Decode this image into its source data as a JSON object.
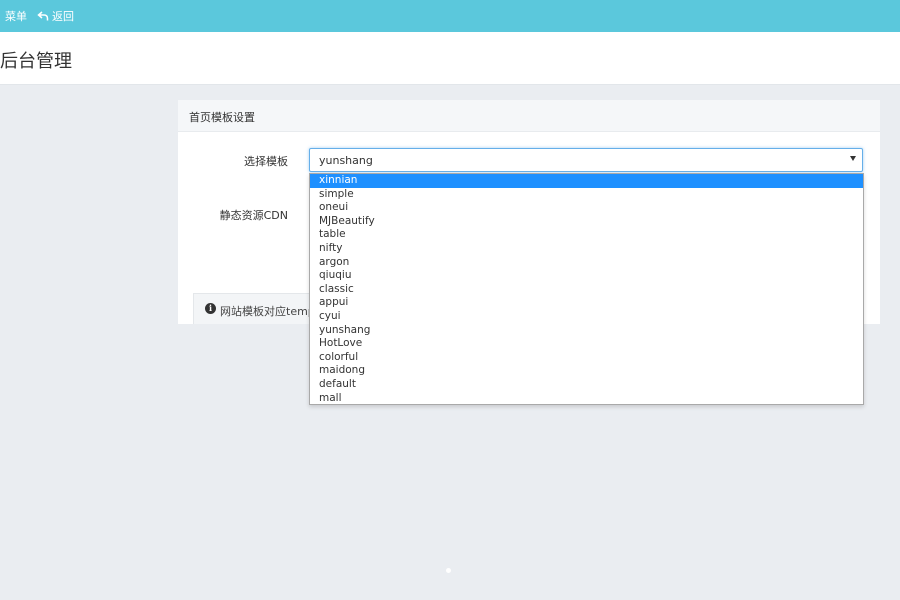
{
  "topbar": {
    "menu_label": "菜单",
    "back_label": "返回"
  },
  "header": {
    "title": "后台管理"
  },
  "panel": {
    "heading": "首页模板设置",
    "template_label": "选择模板",
    "template_value": "yunshang",
    "cdn_label": "静态资源CDN",
    "tip_text": "网站模板对应templ"
  },
  "dropdown": {
    "options": [
      "xinnian",
      "simple",
      "oneui",
      "MJBeautify",
      "table",
      "nifty",
      "argon",
      "qiuqiu",
      "classic",
      "appui",
      "cyui",
      "yunshang",
      "HotLove",
      "colorful",
      "maidong",
      "default",
      "mall"
    ],
    "highlighted": "xinnian"
  },
  "colors": {
    "topbar": "#5bc8dc",
    "highlight": "#1e90ff",
    "background": "#eaedf1"
  }
}
